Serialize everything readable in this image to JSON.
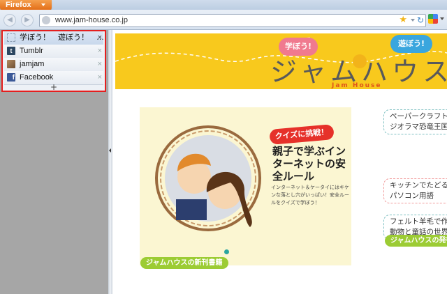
{
  "browser": {
    "app_button_label": "Firefox",
    "url": "www.jam-house.co.jp"
  },
  "sidebar": {
    "tabs": [
      {
        "title": "学ぼう！　遊ぼう！　…",
        "active": true,
        "icon": "dotted-page-icon"
      },
      {
        "title": "Tumblr",
        "active": false,
        "icon": "tumblr-icon",
        "color": "#2c4762"
      },
      {
        "title": "jamjam",
        "active": false,
        "icon": "jamjam-icon",
        "color": "#8b6a4a"
      },
      {
        "title": "Facebook",
        "active": false,
        "icon": "facebook-icon",
        "color": "#3b5998"
      }
    ],
    "close_glyph": "×",
    "add_glyph": "+",
    "highlight_color": "#e51e1e"
  },
  "page": {
    "bubble_learn": "学ぼう!",
    "bubble_play": "遊ぼう!",
    "site_name": "ジャムハウス",
    "site_name_en": "Jam House",
    "feature": {
      "badge": "クイズに挑戦！",
      "title": "親子で学ぶインターネットの安全ルール",
      "description": "インターネット＆ケータイにはキケンな落とし穴がいっぱい！安全ルールをクイズで学ぼう！"
    },
    "links": [
      {
        "text": "ペーパークラフト\nジオラマ恐竜王国"
      },
      {
        "text": "キッチンでたどる\nパソコン用語"
      },
      {
        "text": "フェルト羊毛で作\n動物と童話の世界"
      }
    ],
    "section_new_books": "ジャムハウスの新刊書籍",
    "section_right": "ジャムハウスの発行"
  }
}
